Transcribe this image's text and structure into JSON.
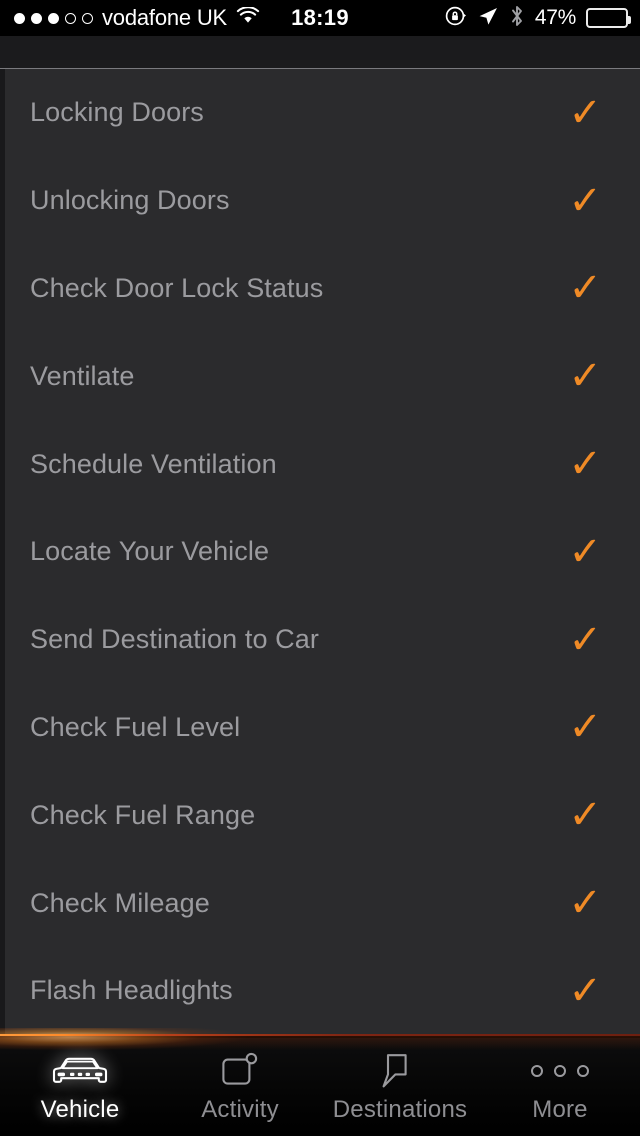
{
  "status_bar": {
    "signal_dots": {
      "filled": 3,
      "empty": 2
    },
    "carrier": "vodafone UK",
    "wifi_icon": "wifi-icon",
    "time": "18:19",
    "rotation_lock_icon": "rotation-lock-icon",
    "location_icon": "location-arrow-icon",
    "bluetooth_icon": "bluetooth-icon",
    "battery_percent": "47%",
    "battery_level": 47
  },
  "list": {
    "rows": [
      {
        "label": "Locking Doors",
        "check": "✓"
      },
      {
        "label": "Unlocking Doors",
        "check": "✓"
      },
      {
        "label": "Check Door Lock Status",
        "check": "✓"
      },
      {
        "label": "Ventilate",
        "check": "✓"
      },
      {
        "label": "Schedule Ventilation",
        "check": "✓"
      },
      {
        "label": "Locate Your Vehicle",
        "check": "✓"
      },
      {
        "label": "Send Destination to Car",
        "check": "✓"
      },
      {
        "label": "Check Fuel Level",
        "check": "✓"
      },
      {
        "label": "Check Fuel Range",
        "check": "✓"
      },
      {
        "label": "Check Mileage",
        "check": "✓"
      },
      {
        "label": "Flash Headlights",
        "check": "✓"
      }
    ]
  },
  "tab_bar": {
    "tabs": [
      {
        "label": "Vehicle",
        "icon": "car-front-icon",
        "active": true
      },
      {
        "label": "Activity",
        "icon": "activity-badge-icon",
        "active": false
      },
      {
        "label": "Destinations",
        "icon": "speech-bubble-icon",
        "active": false
      },
      {
        "label": "More",
        "icon": "three-dots-icon",
        "active": false
      }
    ]
  },
  "colors": {
    "accent_orange": "#ef8a26",
    "horizon_line": "#ff8a28",
    "list_background": "#2b2b2d",
    "row_text": "#9b9b9f",
    "tab_inactive": "#8e8e92",
    "tab_active": "#ffffff"
  }
}
